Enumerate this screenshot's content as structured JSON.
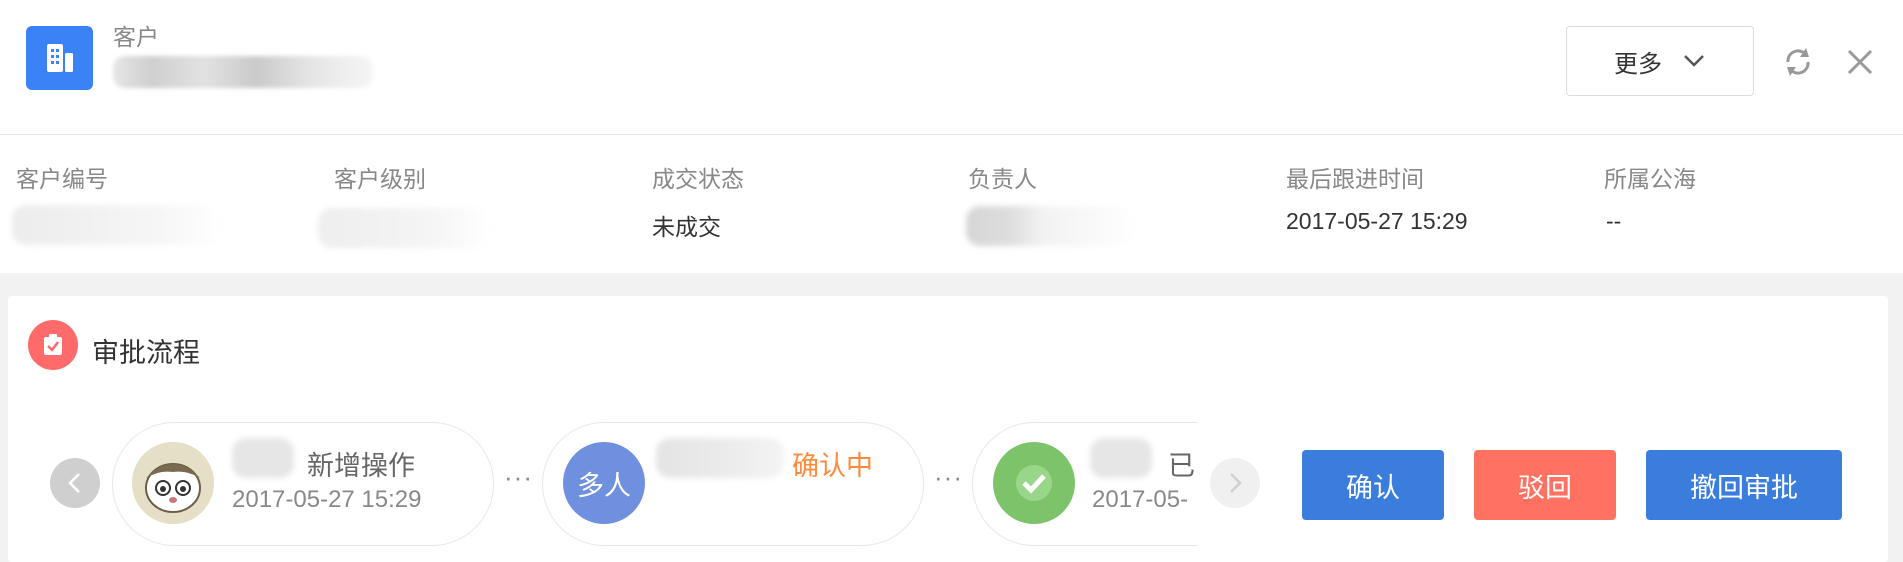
{
  "header": {
    "object_type": "客户",
    "more_label": "更多"
  },
  "fields": [
    {
      "label": "客户编号",
      "value": ""
    },
    {
      "label": "客户级别",
      "value": ""
    },
    {
      "label": "成交状态",
      "value": "未成交"
    },
    {
      "label": "负责人",
      "value": ""
    },
    {
      "label": "最后跟进时间",
      "value": "2017-05-27 15:29"
    },
    {
      "label": "所属公海",
      "value": "--"
    }
  ],
  "approval": {
    "title": "审批流程",
    "steps": [
      {
        "action": "新增操作",
        "time": "2017-05-27 15:29"
      },
      {
        "avatar_text": "多人",
        "status": "确认中"
      },
      {
        "action": "已",
        "time": "2017-05-"
      }
    ],
    "ellipsis": "···"
  },
  "actions": {
    "confirm_label": "确认",
    "reject_label": "驳回",
    "withdraw_label": "撤回审批"
  },
  "colors": {
    "primary": "#3b7ddd",
    "danger": "#ff7262",
    "pending": "#ff8a3c",
    "avatar_multi": "#6f8fdf",
    "avatar_done": "#7cc36a"
  }
}
